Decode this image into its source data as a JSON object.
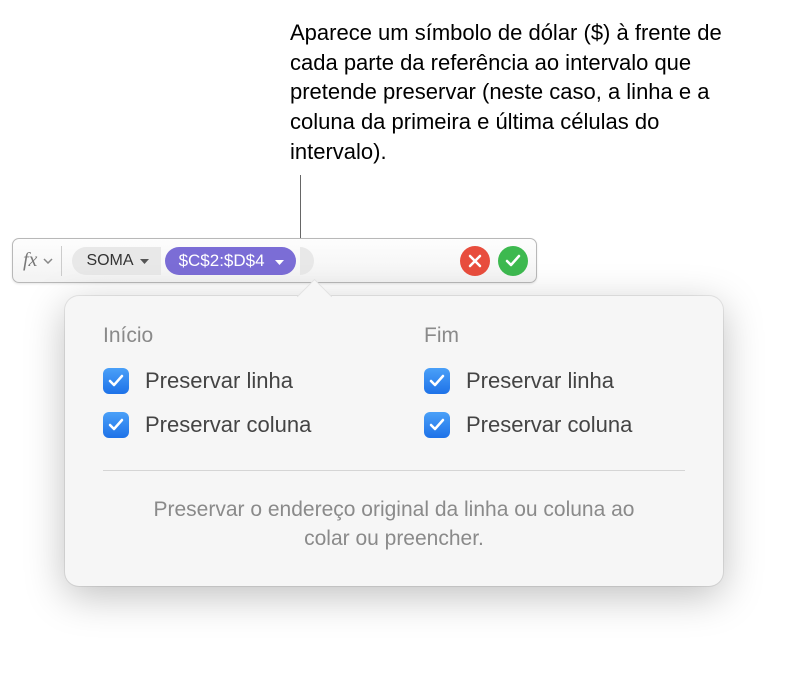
{
  "annotation": {
    "text": "Aparece um símbolo de dólar ($) à frente de cada parte da referência ao intervalo que pretende preservar (neste caso, a linha e a coluna da primeira e última células do intervalo)."
  },
  "formula_bar": {
    "fx_label": "fx",
    "function_name": "SOMA",
    "range_reference": "$C$2:$D$4"
  },
  "popover": {
    "start": {
      "header": "Início",
      "preserve_row": "Preservar linha",
      "preserve_column": "Preservar coluna"
    },
    "end": {
      "header": "Fim",
      "preserve_row": "Preservar linha",
      "preserve_column": "Preservar coluna"
    },
    "description": "Preservar o endereço original da linha ou coluna ao colar ou preencher."
  }
}
